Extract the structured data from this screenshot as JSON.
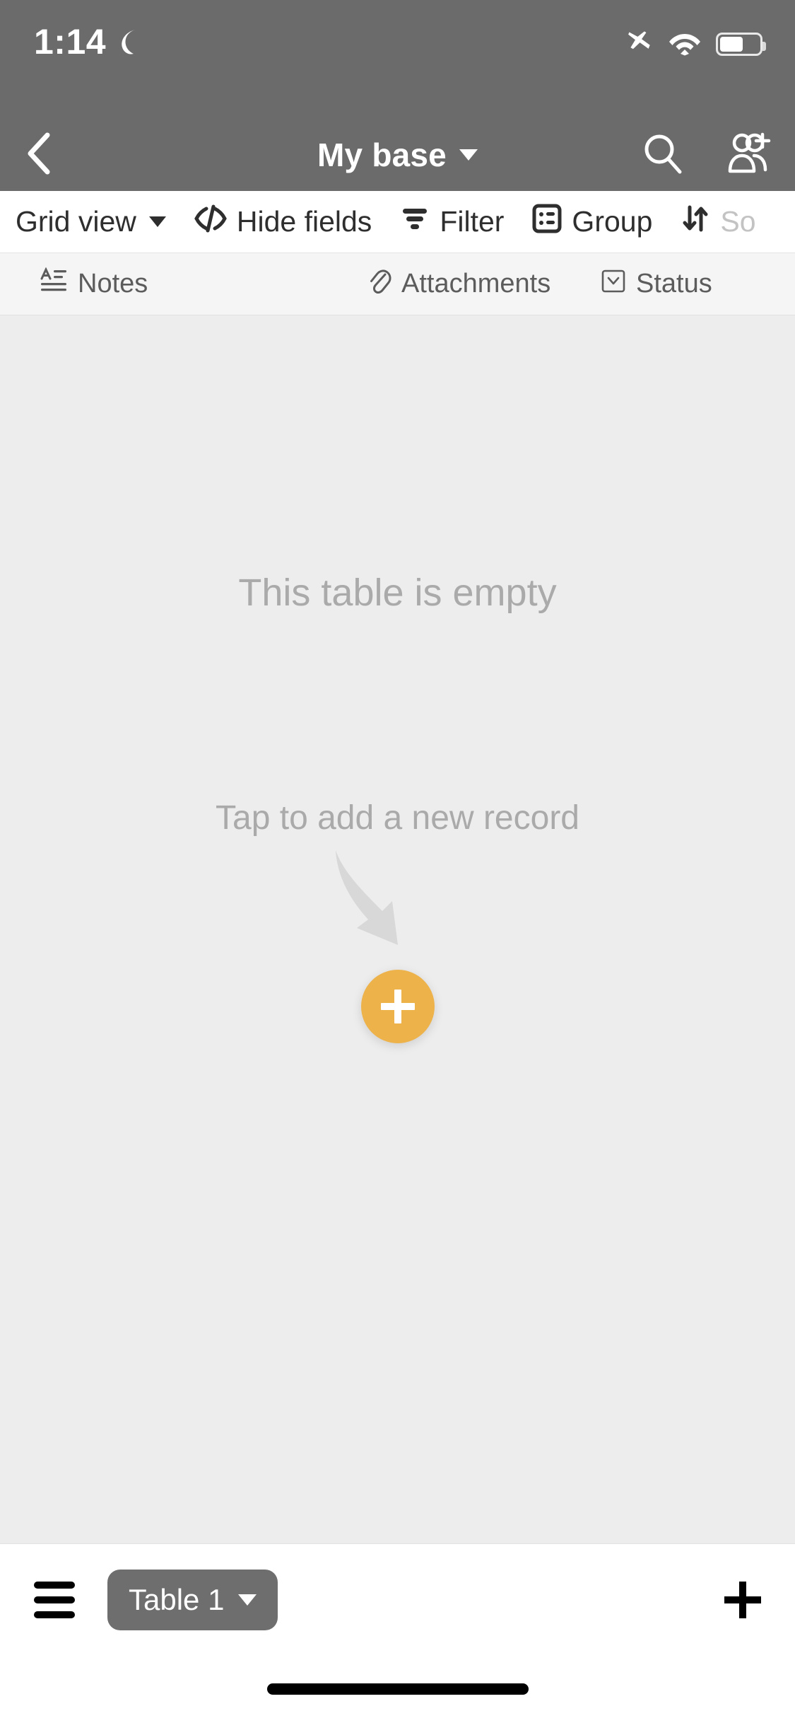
{
  "status_bar": {
    "time": "1:14",
    "icons": [
      "moon-icon",
      "airplane-icon",
      "wifi-icon",
      "battery-icon"
    ],
    "battery_level_pct": 60,
    "background_color": "#6b6b6b"
  },
  "nav_bar": {
    "back_icon": "chevron-left-icon",
    "title": "My base",
    "title_caret_icon": "caret-down-icon",
    "search_icon": "search-icon",
    "add_collaborator_icon": "add-people-icon",
    "background_color": "#6b6b6b"
  },
  "toolbar": {
    "items": [
      {
        "label": "Grid view",
        "icon": "grid-view-icon",
        "has_caret": true,
        "faded": false
      },
      {
        "label": "Hide fields",
        "icon": "hide-fields-icon",
        "has_caret": false,
        "faded": false
      },
      {
        "label": "Filter",
        "icon": "filter-icon",
        "has_caret": false,
        "faded": false
      },
      {
        "label": "Group",
        "icon": "group-icon",
        "has_caret": false,
        "faded": false
      },
      {
        "label": "So",
        "icon": "sort-icon",
        "has_caret": false,
        "faded": true
      }
    ]
  },
  "field_header": {
    "fields": [
      {
        "label": "Notes",
        "icon": "long-text-icon"
      },
      {
        "label": "Attachments",
        "icon": "paperclip-icon"
      },
      {
        "label": "Status",
        "icon": "single-select-icon"
      }
    ]
  },
  "grid": {
    "empty_title": "This table is empty",
    "empty_subtitle": "Tap to add a new record",
    "arrow_icon": "curved-down-arrow-icon",
    "add_record_icon": "plus-icon",
    "add_record_color": "#edb24a",
    "background_color": "#ededed"
  },
  "bottom_bar": {
    "menu_icon": "hamburger-menu-icon",
    "active_table": "Table 1",
    "table_caret_icon": "caret-down-icon",
    "add_table_icon": "plus-icon"
  }
}
